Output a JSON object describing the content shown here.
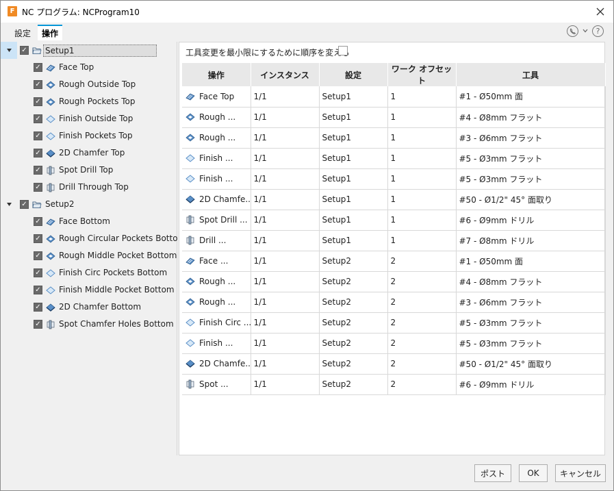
{
  "window": {
    "app_icon_letter": "F",
    "title": "NC プログラム: NCProgram10"
  },
  "tabs": [
    {
      "label": "設定"
    },
    {
      "label": "操作"
    }
  ],
  "tree": {
    "setups": [
      {
        "label": "Setup1",
        "ops": [
          {
            "label": "Face Top",
            "icon": "face-icon"
          },
          {
            "label": "Rough Outside Top",
            "icon": "rough-icon"
          },
          {
            "label": "Rough Pockets Top",
            "icon": "rough-icon"
          },
          {
            "label": "Finish Outside Top",
            "icon": "finish-icon"
          },
          {
            "label": "Finish Pockets Top",
            "icon": "finish-icon"
          },
          {
            "label": "2D Chamfer Top",
            "icon": "chamfer-icon"
          },
          {
            "label": "Spot Drill Top",
            "icon": "drill-icon"
          },
          {
            "label": "Drill Through Top",
            "icon": "drill-icon"
          }
        ]
      },
      {
        "label": "Setup2",
        "ops": [
          {
            "label": "Face Bottom",
            "icon": "face-icon"
          },
          {
            "label": "Rough Circular Pockets Botto",
            "icon": "rough-icon"
          },
          {
            "label": "Rough Middle Pocket Bottom",
            "icon": "rough-icon"
          },
          {
            "label": "Finish Circ Pockets Bottom",
            "icon": "finish-icon"
          },
          {
            "label": "Finish Middle Pocket Bottom",
            "icon": "finish-icon"
          },
          {
            "label": "2D Chamfer Bottom",
            "icon": "chamfer-icon"
          },
          {
            "label": "Spot Chamfer Holes Bottom",
            "icon": "drill-icon"
          }
        ]
      }
    ]
  },
  "reorder_label": "工具変更を最小限にするために順序を変える",
  "table": {
    "headers": [
      "操作",
      "インスタンス",
      "設定",
      "ワーク オフセット",
      "工具"
    ],
    "rows": [
      {
        "op": "Face Top",
        "icon": "face-icon",
        "inst": "1/1",
        "setup": "Setup1",
        "offset": "1",
        "tool": "#1 - Ø50mm 面"
      },
      {
        "op": "Rough ...",
        "icon": "rough-icon",
        "inst": "1/1",
        "setup": "Setup1",
        "offset": "1",
        "tool": "#4 - Ø8mm フラット"
      },
      {
        "op": "Rough ...",
        "icon": "rough-icon",
        "inst": "1/1",
        "setup": "Setup1",
        "offset": "1",
        "tool": "#3 - Ø6mm フラット"
      },
      {
        "op": "Finish ...",
        "icon": "finish-icon",
        "inst": "1/1",
        "setup": "Setup1",
        "offset": "1",
        "tool": "#5 - Ø3mm フラット"
      },
      {
        "op": "Finish ...",
        "icon": "finish-icon",
        "inst": "1/1",
        "setup": "Setup1",
        "offset": "1",
        "tool": "#5 - Ø3mm フラット"
      },
      {
        "op": "2D Chamfe...",
        "icon": "chamfer-icon",
        "inst": "1/1",
        "setup": "Setup1",
        "offset": "1",
        "tool": "#50 - Ø1/2\" 45° 面取り"
      },
      {
        "op": "Spot Drill ...",
        "icon": "drill-icon",
        "inst": "1/1",
        "setup": "Setup1",
        "offset": "1",
        "tool": "#6 - Ø9mm ドリル"
      },
      {
        "op": "Drill ...",
        "icon": "drill-icon",
        "inst": "1/1",
        "setup": "Setup1",
        "offset": "1",
        "tool": "#7 - Ø8mm ドリル"
      },
      {
        "op": "Face ...",
        "icon": "face-icon",
        "inst": "1/1",
        "setup": "Setup2",
        "offset": "2",
        "tool": "#1 - Ø50mm 面"
      },
      {
        "op": "Rough ...",
        "icon": "rough-icon",
        "inst": "1/1",
        "setup": "Setup2",
        "offset": "2",
        "tool": "#4 - Ø8mm フラット"
      },
      {
        "op": "Rough ...",
        "icon": "rough-icon",
        "inst": "1/1",
        "setup": "Setup2",
        "offset": "2",
        "tool": "#3 - Ø6mm フラット"
      },
      {
        "op": "Finish Circ ...",
        "icon": "finish-icon",
        "inst": "1/1",
        "setup": "Setup2",
        "offset": "2",
        "tool": "#5 - Ø3mm フラット"
      },
      {
        "op": "Finish ...",
        "icon": "finish-icon",
        "inst": "1/1",
        "setup": "Setup2",
        "offset": "2",
        "tool": "#5 - Ø3mm フラット"
      },
      {
        "op": "2D Chamfe...",
        "icon": "chamfer-icon",
        "inst": "1/1",
        "setup": "Setup2",
        "offset": "2",
        "tool": "#50 - Ø1/2\" 45° 面取り"
      },
      {
        "op": "Spot ...",
        "icon": "drill-icon",
        "inst": "1/1",
        "setup": "Setup2",
        "offset": "2",
        "tool": "#6 - Ø9mm ドリル"
      }
    ]
  },
  "buttons": {
    "post": "ポスト",
    "ok": "OK",
    "cancel": "キャンセル"
  },
  "colors": {
    "accent": "#0696d7",
    "app_icon": "#f08a24",
    "selection": "#cce4f7"
  }
}
